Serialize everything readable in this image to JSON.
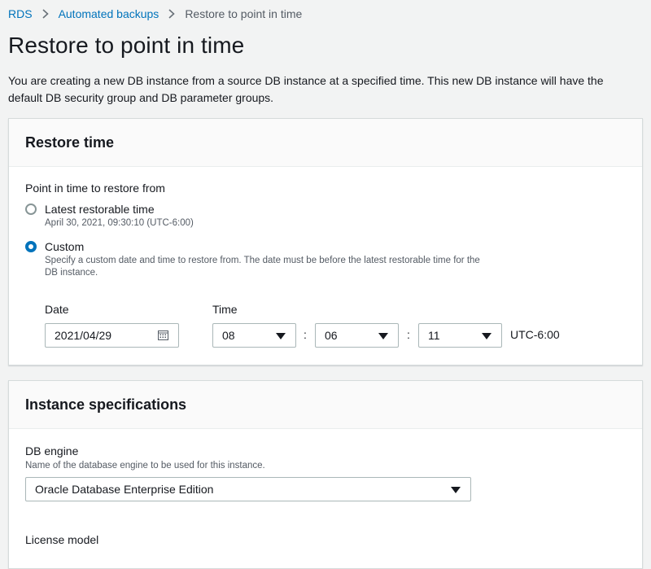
{
  "breadcrumb": {
    "items": [
      "RDS",
      "Automated backups"
    ],
    "current": "Restore to point in time"
  },
  "page": {
    "title": "Restore to point in time",
    "description": "You are creating a new DB instance from a source DB instance at a specified time. This new DB instance will have the default DB security group and DB parameter groups."
  },
  "restore_time": {
    "header": "Restore time",
    "field_label": "Point in time to restore from",
    "options": [
      {
        "label": "Latest restorable time",
        "description": "April 30, 2021, 09:30:10 (UTC-6:00)",
        "selected": false
      },
      {
        "label": "Custom",
        "description": "Specify a custom date and time to restore from. The date must be before the latest restorable time for the DB instance.",
        "selected": true
      }
    ],
    "date_label": "Date",
    "date_value": "2021/04/29",
    "time_label": "Time",
    "hour": "08",
    "minute": "06",
    "second": "11",
    "timezone": "UTC-6:00"
  },
  "instance_specs": {
    "header": "Instance specifications",
    "db_engine_label": "DB engine",
    "db_engine_desc": "Name of the database engine to be used for this instance.",
    "db_engine_value": "Oracle Database Enterprise Edition",
    "license_model_label": "License model"
  },
  "icons": {
    "breadcrumb_separator": "chevron-right-icon",
    "date_picker": "calendar-icon",
    "dropdown": "caret-down-icon"
  },
  "colors": {
    "link": "#0073bb",
    "radio_selected": "#0073bb",
    "background": "#f2f3f3"
  }
}
